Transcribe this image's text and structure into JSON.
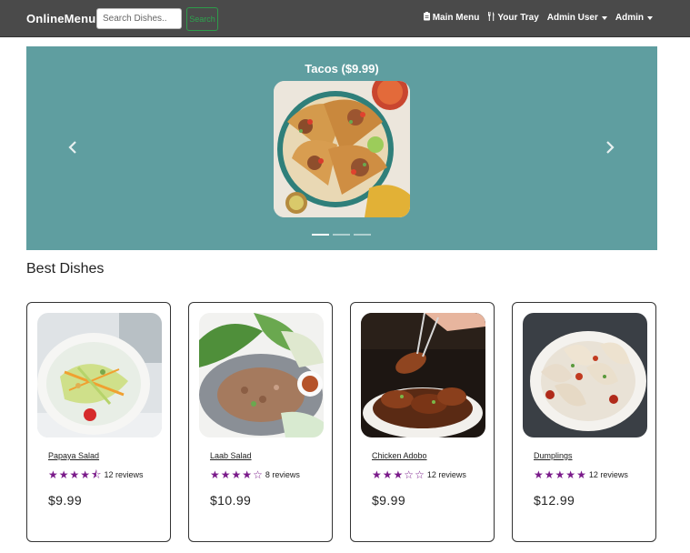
{
  "navbar": {
    "brand": "OnlineMenu",
    "search_placeholder": "Search Dishes..",
    "search_button": "Search",
    "links": [
      {
        "icon": "menu-icon",
        "label": "Main Menu"
      },
      {
        "icon": "utensils-icon",
        "label": "Your Tray"
      },
      {
        "icon": "",
        "label": "Admin User"
      },
      {
        "icon": "",
        "label": "Admin"
      }
    ]
  },
  "carousel": {
    "caption": "Tacos ($9.99)",
    "slides": 3,
    "active_slide": 1,
    "background": "#5f9ea0"
  },
  "best_dishes": {
    "title": "Best Dishes",
    "items": [
      {
        "name": "Papaya Salad",
        "rating": 4.5,
        "reviews": "12 reviews",
        "price": "$9.99"
      },
      {
        "name": "Laab Salad",
        "rating": 4,
        "reviews": "8 reviews",
        "price": "$10.99"
      },
      {
        "name": "Chicken Adobo",
        "rating": 3,
        "reviews": "12 reviews",
        "price": "$9.99"
      },
      {
        "name": "Dumplings",
        "rating": 5,
        "reviews": "12 reviews",
        "price": "$12.99"
      }
    ]
  },
  "colors": {
    "navbar": "#4a4a4a",
    "star": "#7a1a8a",
    "search_button": "#2ea34e"
  }
}
